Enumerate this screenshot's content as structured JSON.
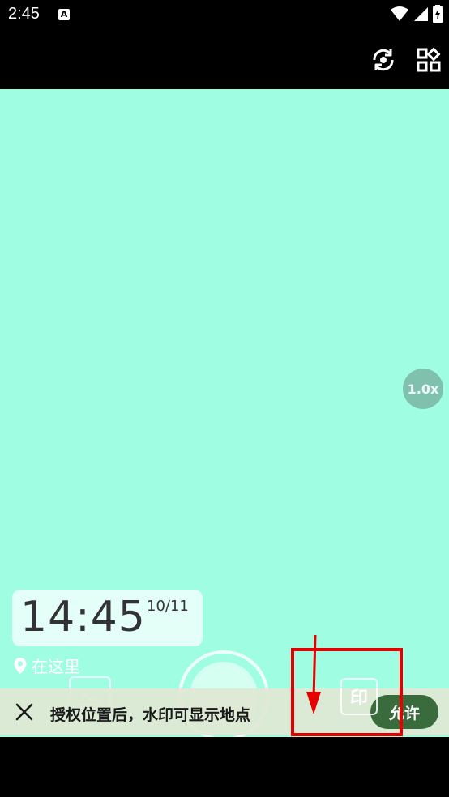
{
  "status_bar": {
    "time": "2:45",
    "notification_letter": "A",
    "icons": [
      "wifi-icon",
      "signal-icon",
      "battery-charging-icon"
    ]
  },
  "top_bar": {
    "icons": [
      "switch-camera-icon",
      "apps-grid-icon"
    ]
  },
  "viewfinder": {
    "background_color": "#9ffee1",
    "zoom_level": "1.0x"
  },
  "watermark": {
    "time": "14:45",
    "date": "10/11",
    "location": "在这里"
  },
  "controls": {
    "watermark_button_label": "印",
    "icons": [
      "gallery-icon",
      "shutter-button",
      "watermark-icon"
    ]
  },
  "permission_banner": {
    "message": "授权位置后，水印可显示地点",
    "allow_label": "允许",
    "accent_color": "#3a6b3c"
  },
  "annotation": {
    "color": "#e60000"
  }
}
